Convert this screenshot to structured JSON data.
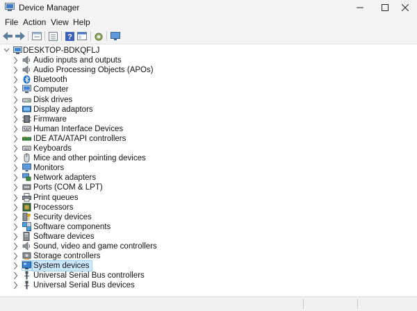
{
  "window": {
    "title": "Device Manager"
  },
  "menu": [
    "File",
    "Action",
    "View",
    "Help"
  ],
  "toolbar": {
    "buttons": [
      "back-arrow-icon",
      "forward-arrow-icon",
      "properties-icon",
      "details-icon",
      "help-icon",
      "view-icon",
      "scan-hardware-icon",
      "monitor-icon"
    ]
  },
  "tree": {
    "root": "DESKTOP-BDKQFLJ",
    "selected_index": 21,
    "items": [
      {
        "label": "Audio inputs and outputs",
        "icon": "speaker-icon"
      },
      {
        "label": "Audio Processing Objects (APOs)",
        "icon": "speaker-icon"
      },
      {
        "label": "Bluetooth",
        "icon": "bluetooth-icon"
      },
      {
        "label": "Computer",
        "icon": "computer-icon"
      },
      {
        "label": "Disk drives",
        "icon": "disk-drive-icon"
      },
      {
        "label": "Display adaptors",
        "icon": "display-adapter-icon"
      },
      {
        "label": "Firmware",
        "icon": "firmware-icon"
      },
      {
        "label": "Human Interface Devices",
        "icon": "hid-icon"
      },
      {
        "label": "IDE ATA/ATAPI controllers",
        "icon": "ide-controller-icon"
      },
      {
        "label": "Keyboards",
        "icon": "keyboard-icon"
      },
      {
        "label": "Mice and other pointing devices",
        "icon": "mouse-icon"
      },
      {
        "label": "Monitors",
        "icon": "monitor-icon"
      },
      {
        "label": "Network adapters",
        "icon": "network-adapter-icon"
      },
      {
        "label": "Ports (COM & LPT)",
        "icon": "port-icon"
      },
      {
        "label": "Print queues",
        "icon": "printer-icon"
      },
      {
        "label": "Processors",
        "icon": "processor-icon"
      },
      {
        "label": "Security devices",
        "icon": "security-key-icon"
      },
      {
        "label": "Software components",
        "icon": "software-component-icon"
      },
      {
        "label": "Software devices",
        "icon": "software-device-icon"
      },
      {
        "label": "Sound, video and game controllers",
        "icon": "speaker-icon"
      },
      {
        "label": "Storage controllers",
        "icon": "storage-controller-icon"
      },
      {
        "label": "System devices",
        "icon": "system-devices-icon"
      },
      {
        "label": "Universal Serial Bus controllers",
        "icon": "usb-icon"
      },
      {
        "label": "Universal Serial Bus devices",
        "icon": "usb-icon"
      }
    ]
  },
  "colors": {
    "chrome": "#f3f3f3",
    "selection": "#cce8ff",
    "selection_border": "#99d1ff"
  }
}
